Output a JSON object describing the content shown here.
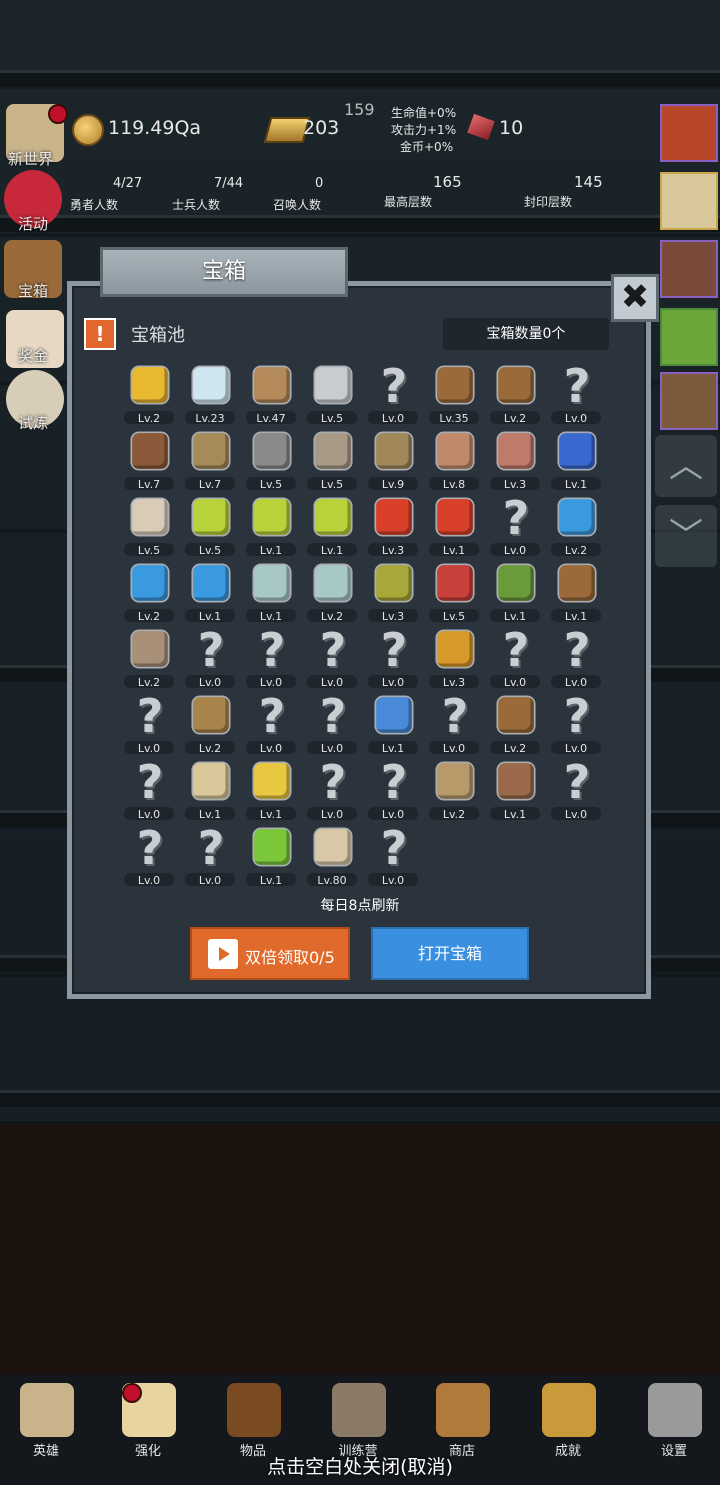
{
  "hud": {
    "gold": "119.49Qa",
    "gold_bars": "203",
    "boss_hp": "159",
    "bonus_hp": "生命值+0%",
    "bonus_atk": "攻击力+1%",
    "bonus_gold": "金币+0%",
    "gems": "10",
    "hero_count": "4/27",
    "hero_label": "勇者人数",
    "soldier_count": "7/44",
    "soldier_label": "士兵人数",
    "summon_count": "0",
    "summon_label": "召唤人数",
    "top_floor": "165",
    "top_floor_label": "最高层数",
    "sealed_floor": "145",
    "sealed_floor_label": "封印层数"
  },
  "left_menu": [
    {
      "label": "新世界"
    },
    {
      "label": "活动"
    },
    {
      "label": "宝箱"
    },
    {
      "label": "奖金"
    },
    {
      "label": "试炼"
    }
  ],
  "dialog": {
    "title": "宝箱",
    "close": "✖",
    "warn": "!",
    "pool_label": "宝箱池",
    "chest_count": "宝箱数量0个",
    "refresh_note": "每日8点刷新",
    "double_button": "双倍领取0/5",
    "open_button": "打开宝箱"
  },
  "items": [
    {
      "icon": "crown-icon",
      "lv": "Lv.2"
    },
    {
      "icon": "diamond-icon",
      "lv": "Lv.23"
    },
    {
      "icon": "wooden-sword-icon",
      "lv": "Lv.47"
    },
    {
      "icon": "sword-icon",
      "lv": "Lv.5"
    },
    {
      "icon": "unknown-icon",
      "lv": "Lv.0"
    },
    {
      "icon": "backpack-icon",
      "lv": "Lv.35"
    },
    {
      "icon": "backpack-icon",
      "lv": "Lv.2"
    },
    {
      "icon": "unknown-icon",
      "lv": "Lv.0"
    },
    {
      "icon": "leather-helmet-icon",
      "lv": "Lv.7"
    },
    {
      "icon": "dagger-icon",
      "lv": "Lv.7"
    },
    {
      "icon": "knight-helmet-icon",
      "lv": "Lv.5"
    },
    {
      "icon": "hammer-icon",
      "lv": "Lv.5"
    },
    {
      "icon": "great-helmet-icon",
      "lv": "Lv.9"
    },
    {
      "icon": "ham-icon",
      "lv": "Lv.8"
    },
    {
      "icon": "steak-icon",
      "lv": "Lv.3"
    },
    {
      "icon": "pouch-icon",
      "lv": "Lv.1"
    },
    {
      "icon": "rice-bowl-icon",
      "lv": "Lv.5"
    },
    {
      "icon": "green-potion-icon",
      "lv": "Lv.5"
    },
    {
      "icon": "green-potion-icon",
      "lv": "Lv.1"
    },
    {
      "icon": "green-potion-icon",
      "lv": "Lv.1"
    },
    {
      "icon": "red-potion-icon",
      "lv": "Lv.3"
    },
    {
      "icon": "red-potion-icon",
      "lv": "Lv.1"
    },
    {
      "icon": "unknown-icon",
      "lv": "Lv.0"
    },
    {
      "icon": "blue-potion-icon",
      "lv": "Lv.2"
    },
    {
      "icon": "blue-potion-icon",
      "lv": "Lv.2"
    },
    {
      "icon": "blue-potion-icon",
      "lv": "Lv.1"
    },
    {
      "icon": "vial-icon",
      "lv": "Lv.1"
    },
    {
      "icon": "vial-icon",
      "lv": "Lv.2"
    },
    {
      "icon": "olive-flask-icon",
      "lv": "Lv.3"
    },
    {
      "icon": "red-vial-icon",
      "lv": "Lv.5"
    },
    {
      "icon": "winged-boot-icon",
      "lv": "Lv.1"
    },
    {
      "icon": "boot-icon",
      "lv": "Lv.1"
    },
    {
      "icon": "shoe-icon",
      "lv": "Lv.2"
    },
    {
      "icon": "unknown-icon",
      "lv": "Lv.0"
    },
    {
      "icon": "unknown-icon",
      "lv": "Lv.0"
    },
    {
      "icon": "unknown-icon",
      "lv": "Lv.0"
    },
    {
      "icon": "unknown-icon",
      "lv": "Lv.0"
    },
    {
      "icon": "torch-icon",
      "lv": "Lv.3"
    },
    {
      "icon": "unknown-icon",
      "lv": "Lv.0"
    },
    {
      "icon": "unknown-icon",
      "lv": "Lv.0"
    },
    {
      "icon": "unknown-icon",
      "lv": "Lv.0"
    },
    {
      "icon": "staff-icon",
      "lv": "Lv.2"
    },
    {
      "icon": "unknown-icon",
      "lv": "Lv.0"
    },
    {
      "icon": "unknown-icon",
      "lv": "Lv.0"
    },
    {
      "icon": "blue-wand-icon",
      "lv": "Lv.1"
    },
    {
      "icon": "unknown-icon",
      "lv": "Lv.0"
    },
    {
      "icon": "backpack-icon",
      "lv": "Lv.2"
    },
    {
      "icon": "unknown-icon",
      "lv": "Lv.0"
    },
    {
      "icon": "unknown-icon",
      "lv": "Lv.0"
    },
    {
      "icon": "bone-club-icon",
      "lv": "Lv.1"
    },
    {
      "icon": "cheese-icon",
      "lv": "Lv.1"
    },
    {
      "icon": "unknown-icon",
      "lv": "Lv.0"
    },
    {
      "icon": "unknown-icon",
      "lv": "Lv.0"
    },
    {
      "icon": "bow-icon",
      "lv": "Lv.2"
    },
    {
      "icon": "quiver-icon",
      "lv": "Lv.1"
    },
    {
      "icon": "unknown-icon",
      "lv": "Lv.0"
    },
    {
      "icon": "unknown-icon",
      "lv": "Lv.0"
    },
    {
      "icon": "unknown-icon",
      "lv": "Lv.0"
    },
    {
      "icon": "green-wand-icon",
      "lv": "Lv.1"
    },
    {
      "icon": "beer-mug-icon",
      "lv": "Lv.80"
    },
    {
      "icon": "unknown-icon",
      "lv": "Lv.0"
    }
  ],
  "nav": [
    {
      "label": "英雄",
      "icon": "skull-icon",
      "color": "#c9b38a"
    },
    {
      "label": "强化",
      "icon": "candle-icon",
      "color": "#e8d4a0"
    },
    {
      "label": "物品",
      "icon": "book-icon",
      "color": "#7a4a22"
    },
    {
      "label": "训练营",
      "icon": "lantern-icon",
      "color": "#8a7a66"
    },
    {
      "label": "商店",
      "icon": "mug-icon",
      "color": "#b07a3a"
    },
    {
      "label": "成就",
      "icon": "key-icon",
      "color": "#c99a3a"
    },
    {
      "label": "设置",
      "icon": "gear-icon",
      "color": "#9a9a9a"
    }
  ],
  "close_hint": "点击空白处关闭(取消)",
  "colors": {
    "accent_orange": "#e06a2b",
    "accent_blue": "#3a8fe0",
    "panel": "#2b333d"
  }
}
